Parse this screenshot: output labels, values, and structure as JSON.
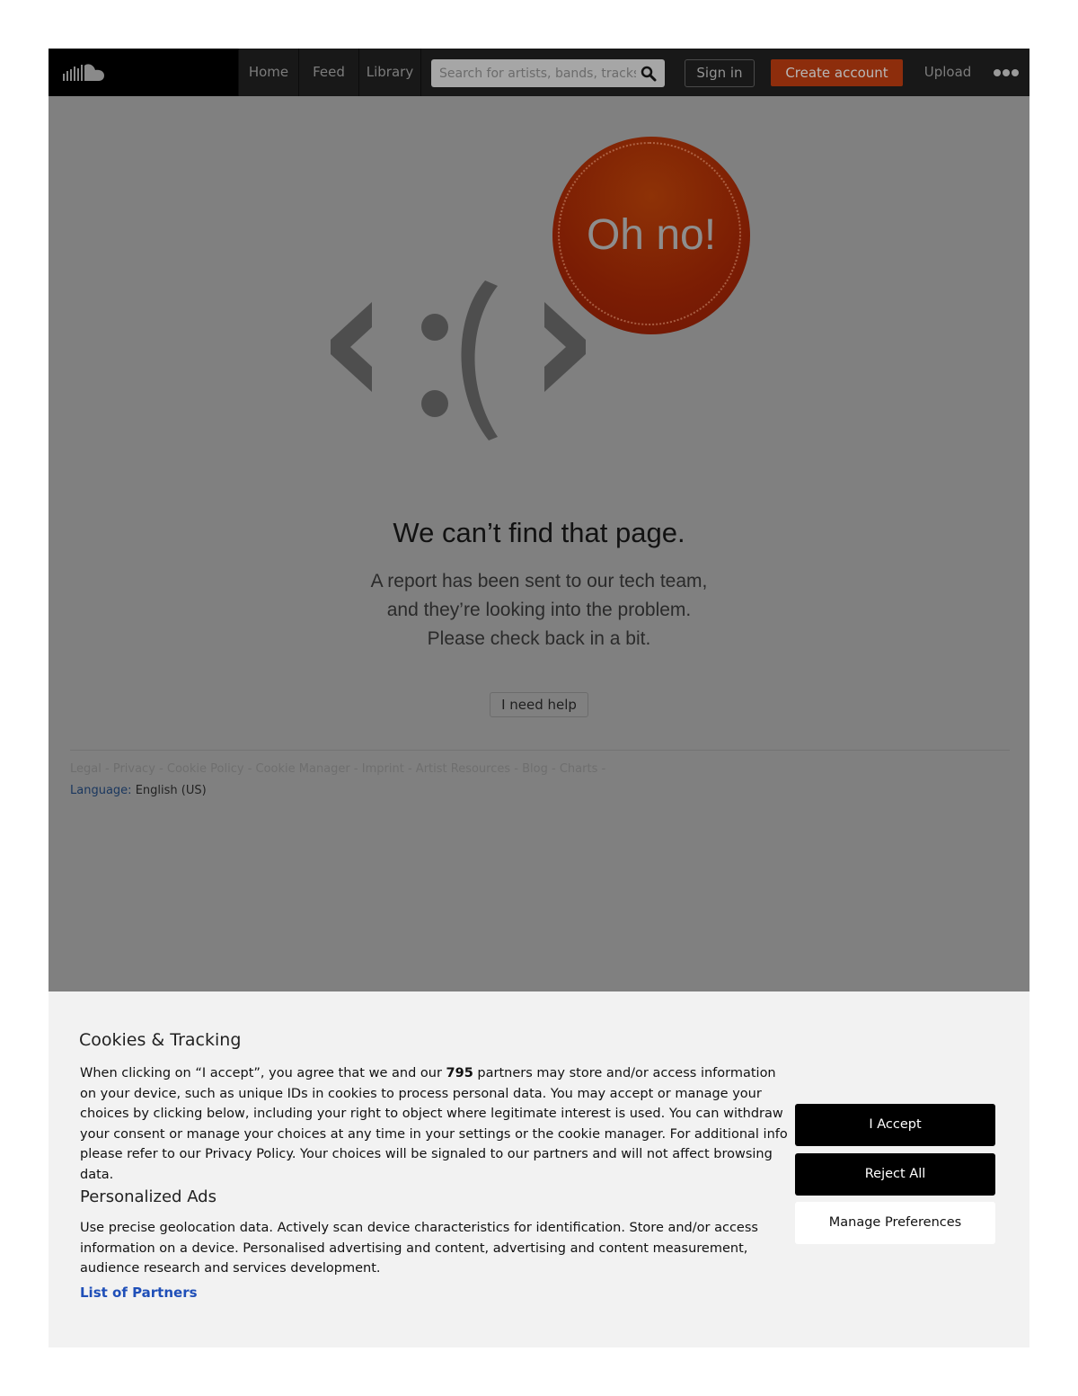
{
  "header": {
    "nav": [
      {
        "label": "Home"
      },
      {
        "label": "Feed"
      },
      {
        "label": "Library"
      }
    ],
    "search_placeholder": "Search for artists, bands, tracks, podcasts",
    "sign_in": "Sign in",
    "create_account": "Create account",
    "upload": "Upload",
    "logo_icon": "soundcloud-logo-icon",
    "more_icon": "more-dots-icon"
  },
  "error": {
    "badge": "Oh no!",
    "title": "We can’t find that page.",
    "message_lines": [
      "A report has been sent to our tech team,",
      "and they’re looking into the problem.",
      "Please check back in a bit."
    ],
    "help_button": "I need help"
  },
  "footer": {
    "links": [
      "Legal",
      "Privacy",
      "Cookie Policy",
      "Cookie Manager",
      "Imprint",
      "Artist Resources",
      "Blog",
      "Charts"
    ],
    "separator": "-",
    "language_label": "Language:",
    "language_value": "English (US)"
  },
  "cookie_banner": {
    "title": "Cookies & Tracking",
    "text_before": "When clicking on “I accept”, you agree that we and our ",
    "partner_count": "795",
    "text_after": " partners may store and/or access information on your device, such as unique IDs in cookies to process personal data. You may accept or manage your choices by clicking below, including your right to object where legitimate interest is used. You can withdraw your consent or manage your choices at any time in your settings or the cookie manager. For additional info please refer to our Privacy Policy. Your choices will be signaled to our partners and will not affect browsing data.",
    "ads_title": "Personalized Ads",
    "ads_text": "Use precise geolocation data. Actively scan device characteristics for identification. Store and/or access information on a device. Personalised advertising and content, advertising and content measurement, audience research and services development.",
    "partners_link": "List of Partners",
    "accept": "I Accept",
    "reject": "Reject All",
    "manage": "Manage Preferences"
  }
}
